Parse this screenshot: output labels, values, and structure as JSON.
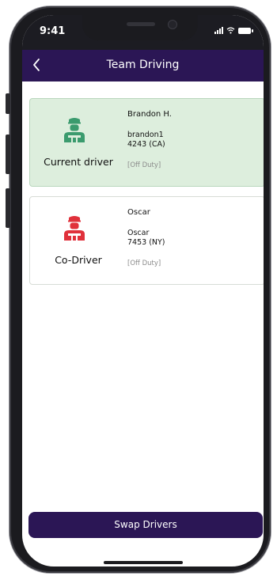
{
  "status_bar": {
    "time": "9:41"
  },
  "header": {
    "title": "Team Driving",
    "back_icon": "chevron-left-icon"
  },
  "drivers": [
    {
      "role": "Current driver",
      "name": "Brandon H.",
      "username": "brandon1",
      "license": "4243 (CA)",
      "status": "[Off Duty]",
      "icon": "driver-icon",
      "color": "#3b9b6e",
      "card_bg": "#ddeedd"
    },
    {
      "role": "Co-Driver",
      "name": "Oscar",
      "username": "Oscar",
      "license": "7453 (NY)",
      "status": "[Off Duty]",
      "icon": "driver-icon",
      "color": "#e0313b",
      "card_bg": "#ffffff"
    }
  ],
  "actions": {
    "swap_label": "Swap Drivers"
  },
  "colors": {
    "brand": "#2b1655"
  }
}
